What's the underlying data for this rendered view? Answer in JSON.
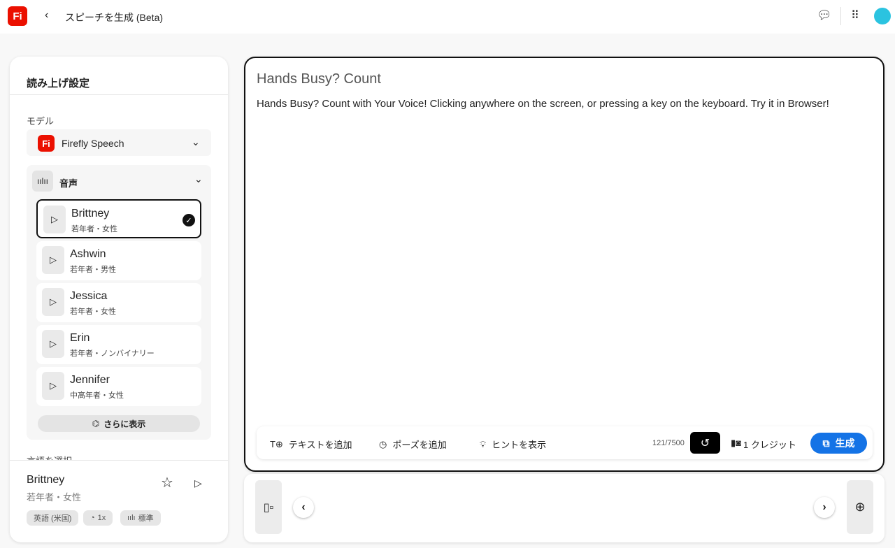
{
  "header": {
    "logo": "Fi",
    "title": "スピーチを生成 (Beta)"
  },
  "settings": {
    "title": "読み上げ設定",
    "model_label": "モデル",
    "model_value": "Firefly Speech",
    "voice_section": "音声",
    "voices": [
      {
        "name": "Brittney",
        "desc": "若年者・女性",
        "selected": true
      },
      {
        "name": "Ashwin",
        "desc": "若年者・男性"
      },
      {
        "name": "Jessica",
        "desc": "若年者・女性"
      },
      {
        "name": "Erin",
        "desc": "若年者・ノンバイナリー"
      },
      {
        "name": "Jennifer",
        "desc": "中高年者・女性"
      }
    ],
    "show_more": "さらに表示",
    "language_label": "言語を選択"
  },
  "current": {
    "name": "Brittney",
    "desc": "若年者・女性",
    "language": "英語 (米国)",
    "speed": "1x",
    "style": "標準"
  },
  "editor": {
    "title": "Hands Busy? Count",
    "text": "Hands Busy? Count with Your Voice! Clicking anywhere on the screen, or pressing a key on the keyboard. Try it in Browser!",
    "add_text": "テキストを追加",
    "add_pause": "ポーズを追加",
    "show_hint": "ヒントを表示",
    "char_count": "121/7500",
    "credits": "1 クレジット",
    "generate": "生成"
  },
  "colors": {
    "accent": "#1473e6",
    "brand": "#eb1000"
  }
}
